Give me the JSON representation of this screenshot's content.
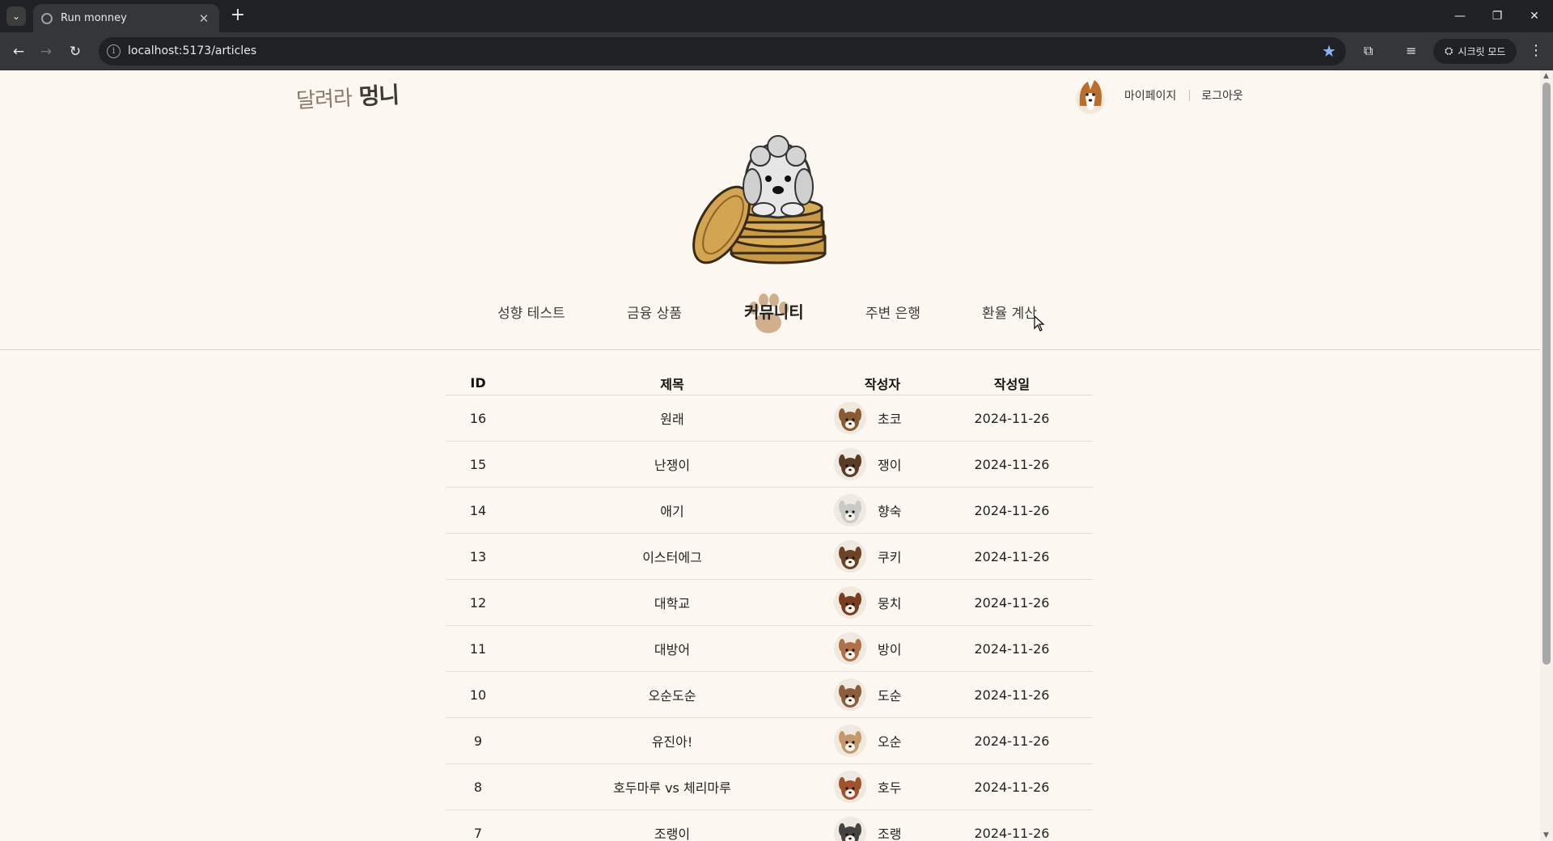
{
  "browser": {
    "tab_title": "Run monney",
    "url": "localhost:5173/articles",
    "incognito_label": "시크릿 모드"
  },
  "header": {
    "logo_text_light": "달려라",
    "logo_text_bold": "멍니",
    "mypage": "마이페이지",
    "logout": "로그아웃"
  },
  "nav": [
    {
      "label": "성향 테스트",
      "active": false
    },
    {
      "label": "금융 상품",
      "active": false
    },
    {
      "label": "커뮤니티",
      "active": true
    },
    {
      "label": "주변 은행",
      "active": false
    },
    {
      "label": "환율 계산",
      "active": false
    }
  ],
  "table": {
    "headers": {
      "id": "ID",
      "title": "제목",
      "author": "작성자",
      "date": "작성일"
    },
    "rows": [
      {
        "id": "16",
        "title": "원래",
        "author": "초코",
        "date": "2024-11-26",
        "avatar_color": "#8a5a33"
      },
      {
        "id": "15",
        "title": "난쟁이",
        "author": "쟁이",
        "date": "2024-11-26",
        "avatar_color": "#5b3b26"
      },
      {
        "id": "14",
        "title": "애기",
        "author": "향숙",
        "date": "2024-11-26",
        "avatar_color": "#c9c9c9"
      },
      {
        "id": "13",
        "title": "이스터에그",
        "author": "쿠키",
        "date": "2024-11-26",
        "avatar_color": "#6b4426"
      },
      {
        "id": "12",
        "title": "대학교",
        "author": "뭉치",
        "date": "2024-11-26",
        "avatar_color": "#7a3e1e"
      },
      {
        "id": "11",
        "title": "대방어",
        "author": "방이",
        "date": "2024-11-26",
        "avatar_color": "#b07048"
      },
      {
        "id": "10",
        "title": "오순도순",
        "author": "도순",
        "date": "2024-11-26",
        "avatar_color": "#8b5e3c"
      },
      {
        "id": "9",
        "title": "유진아!",
        "author": "오순",
        "date": "2024-11-26",
        "avatar_color": "#c49a6c"
      },
      {
        "id": "8",
        "title": "호두마루 vs 체리마루",
        "author": "호두",
        "date": "2024-11-26",
        "avatar_color": "#a0522d"
      },
      {
        "id": "7",
        "title": "조랭이",
        "author": "조랭",
        "date": "2024-11-26",
        "avatar_color": "#444444"
      }
    ]
  }
}
